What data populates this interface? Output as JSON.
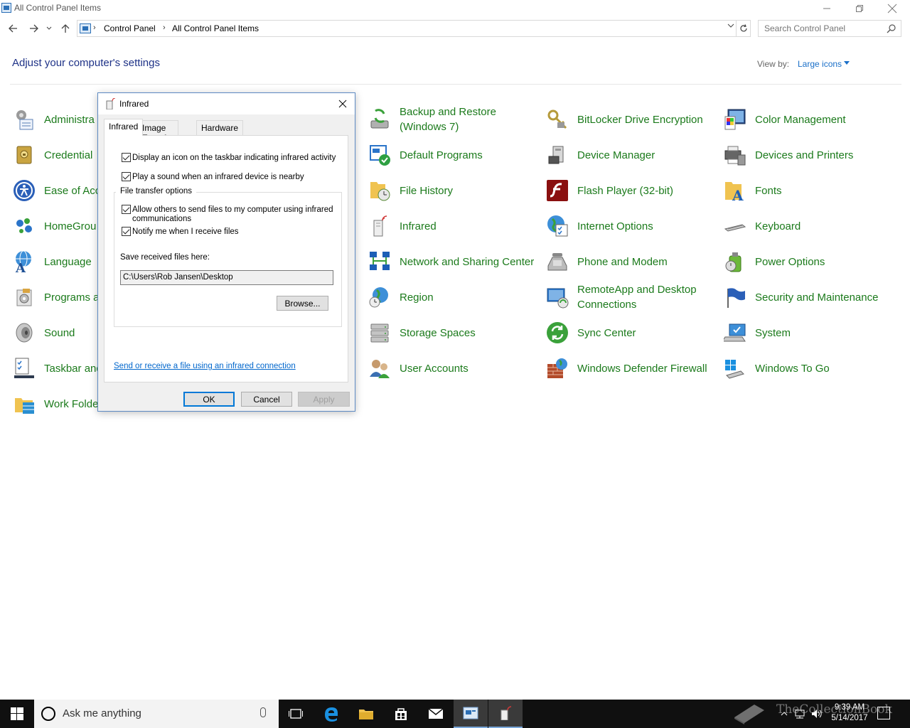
{
  "window": {
    "title": "All Control Panel Items",
    "minimize_icon": "minimize-icon",
    "restore_icon": "restore-icon",
    "close_icon": "close-icon"
  },
  "address": {
    "crumbs": [
      "Control Panel",
      "All Control Panel Items"
    ],
    "search_placeholder": "Search Control Panel"
  },
  "header": {
    "title": "Adjust your computer's settings",
    "view_by_label": "View by:",
    "view_by_value": "Large icons"
  },
  "items": [
    {
      "label": "Administra",
      "icon": "admin-tools-icon"
    },
    {
      "label": "Credential",
      "icon": "credential-manager-icon"
    },
    {
      "label": "Ease of Acc",
      "icon": "ease-of-access-icon"
    },
    {
      "label": "HomeGrou",
      "icon": "homegroup-icon"
    },
    {
      "label": "Language",
      "icon": "language-icon"
    },
    {
      "label": "Programs a",
      "icon": "programs-icon"
    },
    {
      "label": "Sound",
      "icon": "sound-icon"
    },
    {
      "label": "Taskbar and",
      "icon": "taskbar-icon"
    },
    {
      "label": "Work Folde",
      "icon": "work-folders-icon"
    },
    {
      "label": "Backup and Restore (Windows 7)",
      "icon": "backup-icon"
    },
    {
      "label": "Default Programs",
      "icon": "default-programs-icon"
    },
    {
      "label": "File History",
      "icon": "file-history-icon"
    },
    {
      "label": "Infrared",
      "icon": "infrared-icon"
    },
    {
      "label": "Network and Sharing Center",
      "icon": "network-icon"
    },
    {
      "label": "Region",
      "icon": "region-icon"
    },
    {
      "label": "Storage Spaces",
      "icon": "storage-icon"
    },
    {
      "label": "User Accounts",
      "icon": "user-accounts-icon"
    },
    {
      "label": "BitLocker Drive Encryption",
      "icon": "bitlocker-icon"
    },
    {
      "label": "Device Manager",
      "icon": "device-manager-icon"
    },
    {
      "label": "Flash Player (32-bit)",
      "icon": "flash-icon"
    },
    {
      "label": "Internet Options",
      "icon": "internet-options-icon"
    },
    {
      "label": "Phone and Modem",
      "icon": "phone-modem-icon"
    },
    {
      "label": "RemoteApp and Desktop Connections",
      "icon": "remoteapp-icon"
    },
    {
      "label": "Sync Center",
      "icon": "sync-center-icon"
    },
    {
      "label": "Windows Defender Firewall",
      "icon": "firewall-icon"
    },
    {
      "label": "Color Management",
      "icon": "color-management-icon"
    },
    {
      "label": "Devices and Printers",
      "icon": "devices-printers-icon"
    },
    {
      "label": "Fonts",
      "icon": "fonts-icon"
    },
    {
      "label": "Keyboard",
      "icon": "keyboard-icon"
    },
    {
      "label": "Power Options",
      "icon": "power-options-icon"
    },
    {
      "label": "Security and Maintenance",
      "icon": "security-icon"
    },
    {
      "label": "System",
      "icon": "system-icon"
    },
    {
      "label": "Windows To Go",
      "icon": "windows-to-go-icon"
    }
  ],
  "dialog": {
    "title": "Infrared",
    "tabs": [
      "Infrared",
      "Image Transfer",
      "Hardware"
    ],
    "active_tab": "Infrared",
    "cb_taskbar": "Display an icon on the taskbar indicating infrared activity",
    "cb_sound": "Play a sound when an infrared device is nearby",
    "group_title": "File transfer options",
    "cb_allow": "Allow others to send files to my computer using infrared communications",
    "cb_notify": "Notify me when I receive files",
    "save_label": "Save received files here:",
    "save_path": "C:\\Users\\Rob Jansen\\Desktop",
    "browse": "Browse...",
    "link": "Send or receive a file using an infrared connection",
    "ok": "OK",
    "cancel": "Cancel",
    "apply": "Apply",
    "checked": [
      true,
      true,
      true,
      true
    ]
  },
  "taskbar": {
    "search_text": "Ask me anything",
    "time": "9:39 AM",
    "date": "5/14/2017",
    "watermark": "TheCollectionBook",
    "accent": "#7aa7d9"
  },
  "colors": {
    "link_green": "#1b7a1b",
    "heading_blue": "#1e3287",
    "link_blue": "#0066cc"
  }
}
